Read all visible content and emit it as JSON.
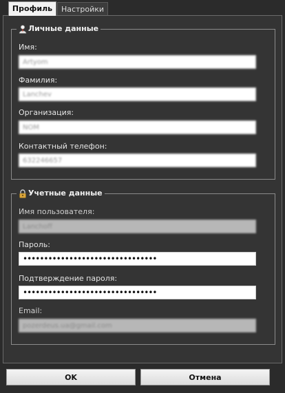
{
  "tabs": [
    {
      "label": "Профиль",
      "active": true
    },
    {
      "label": "Настройки",
      "active": false
    }
  ],
  "personal": {
    "title": "Личные данные",
    "icon": "person-icon",
    "first_name": {
      "label": "Имя:",
      "value": "Artyom"
    },
    "last_name": {
      "label": "Фамилия:",
      "value": "Lanchev"
    },
    "organization": {
      "label": "Организация:",
      "value": "NOM"
    },
    "phone": {
      "label": "Контактный телефон:",
      "value": "632246657"
    }
  },
  "account": {
    "title": "Учетные данные",
    "icon": "lock-icon",
    "username": {
      "label": "Имя пользователя:",
      "value": "Lanchoff"
    },
    "password": {
      "label": "Пароль:",
      "value": "••••••••••••••••••••••••••••••••"
    },
    "password_confirm": {
      "label": "Подтверждение пароля:",
      "value": "••••••••••••••••••••••••••••••••"
    },
    "email": {
      "label": "Email:",
      "value": "pozerdeus.ua@gmail.com"
    }
  },
  "buttons": {
    "ok": "OK",
    "cancel": "Отмена"
  }
}
